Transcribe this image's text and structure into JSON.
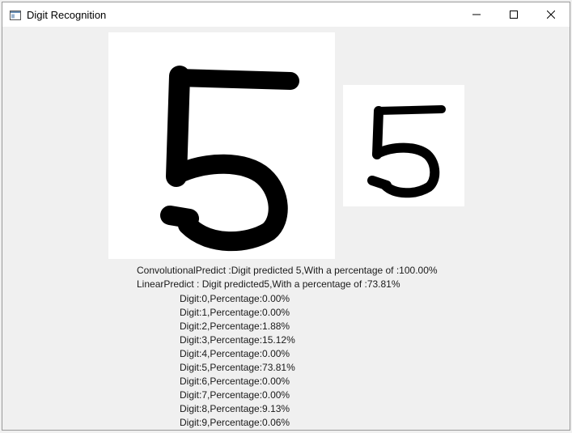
{
  "window": {
    "title": "Digit Recognition",
    "icon": "window-app-icon",
    "controls": {
      "minimize": "minimize-icon",
      "maximize": "maximize-icon",
      "close": "close-icon"
    }
  },
  "canvases": {
    "input": "5",
    "preview": "5"
  },
  "results": {
    "convolutional": "ConvolutionalPredict :Digit predicted 5,With a percentage of :100.00%",
    "linear": "LinearPredict : Digit predicted5,With a percentage of :73.81%",
    "digits": [
      "Digit:0,Percentage:0.00%",
      "Digit:1,Percentage:0.00%",
      "Digit:2,Percentage:1.88%",
      "Digit:3,Percentage:15.12%",
      "Digit:4,Percentage:0.00%",
      "Digit:5,Percentage:73.81%",
      "Digit:6,Percentage:0.00%",
      "Digit:7,Percentage:0.00%",
      "Digit:8,Percentage:9.13%",
      "Digit:9,Percentage:0.06%"
    ]
  }
}
